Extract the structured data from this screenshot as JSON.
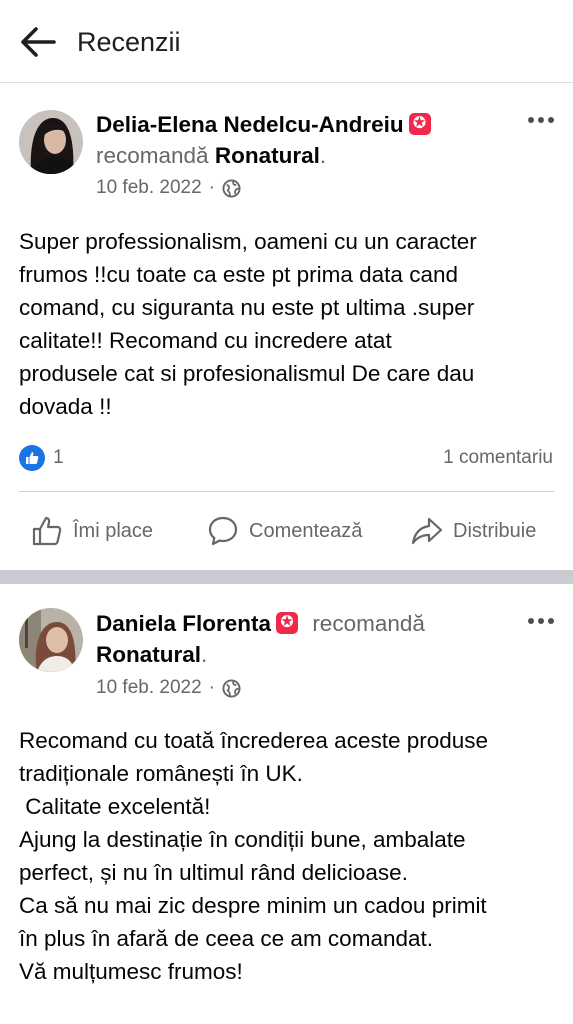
{
  "header": {
    "title": "Recenzii"
  },
  "posts": [
    {
      "author": "Delia-Elena Nedelcu-Andreiu",
      "action_text": "recomandă",
      "page": "Ronatural",
      "date": "10 feb. 2022",
      "separator": "·",
      "text": "Super professionalism, oameni cu un caracter\nfrumos !!cu toate ca este pt prima data cand\ncomand, cu siguranta nu este pt ultima .super\ncalitate!! Recomand cu incredere atat\nprodusele cat si profesionalismul De care dau\ndovada !!",
      "likes": "1",
      "comments": "1 comentariu",
      "actions": {
        "like": "Îmi place",
        "comment": "Comentează",
        "share": "Distribuie"
      }
    },
    {
      "author": "Daniela Florenta",
      "action_text": "recomandă",
      "page": "Ronatural",
      "date": "10 feb. 2022",
      "separator": "·",
      "text": "Recomand cu toată încrederea aceste produse\ntradiționale românești în UK.\n Calitate excelentă!\nAjung la destinație în condiții bune, ambalate\nperfect, și nu în ultimul rând delicioase.\nCa să nu mai zic despre minim un cadou primit\nîn plus în afară de ceea ce am comandat.\nVă mulțumesc frumos!"
    }
  ],
  "icons": {
    "back": "arrow-left-icon",
    "badge": "top-fan-badge-icon",
    "globe": "globe-icon",
    "more": "more-horizontal-icon",
    "like_reaction": "like-reaction-icon",
    "like": "thumbs-up-icon",
    "comment": "comment-bubble-icon",
    "share": "share-arrow-icon"
  },
  "colors": {
    "brand_blue": "#1b74e4",
    "badge_red": "#f02849",
    "muted": "#65676b"
  }
}
